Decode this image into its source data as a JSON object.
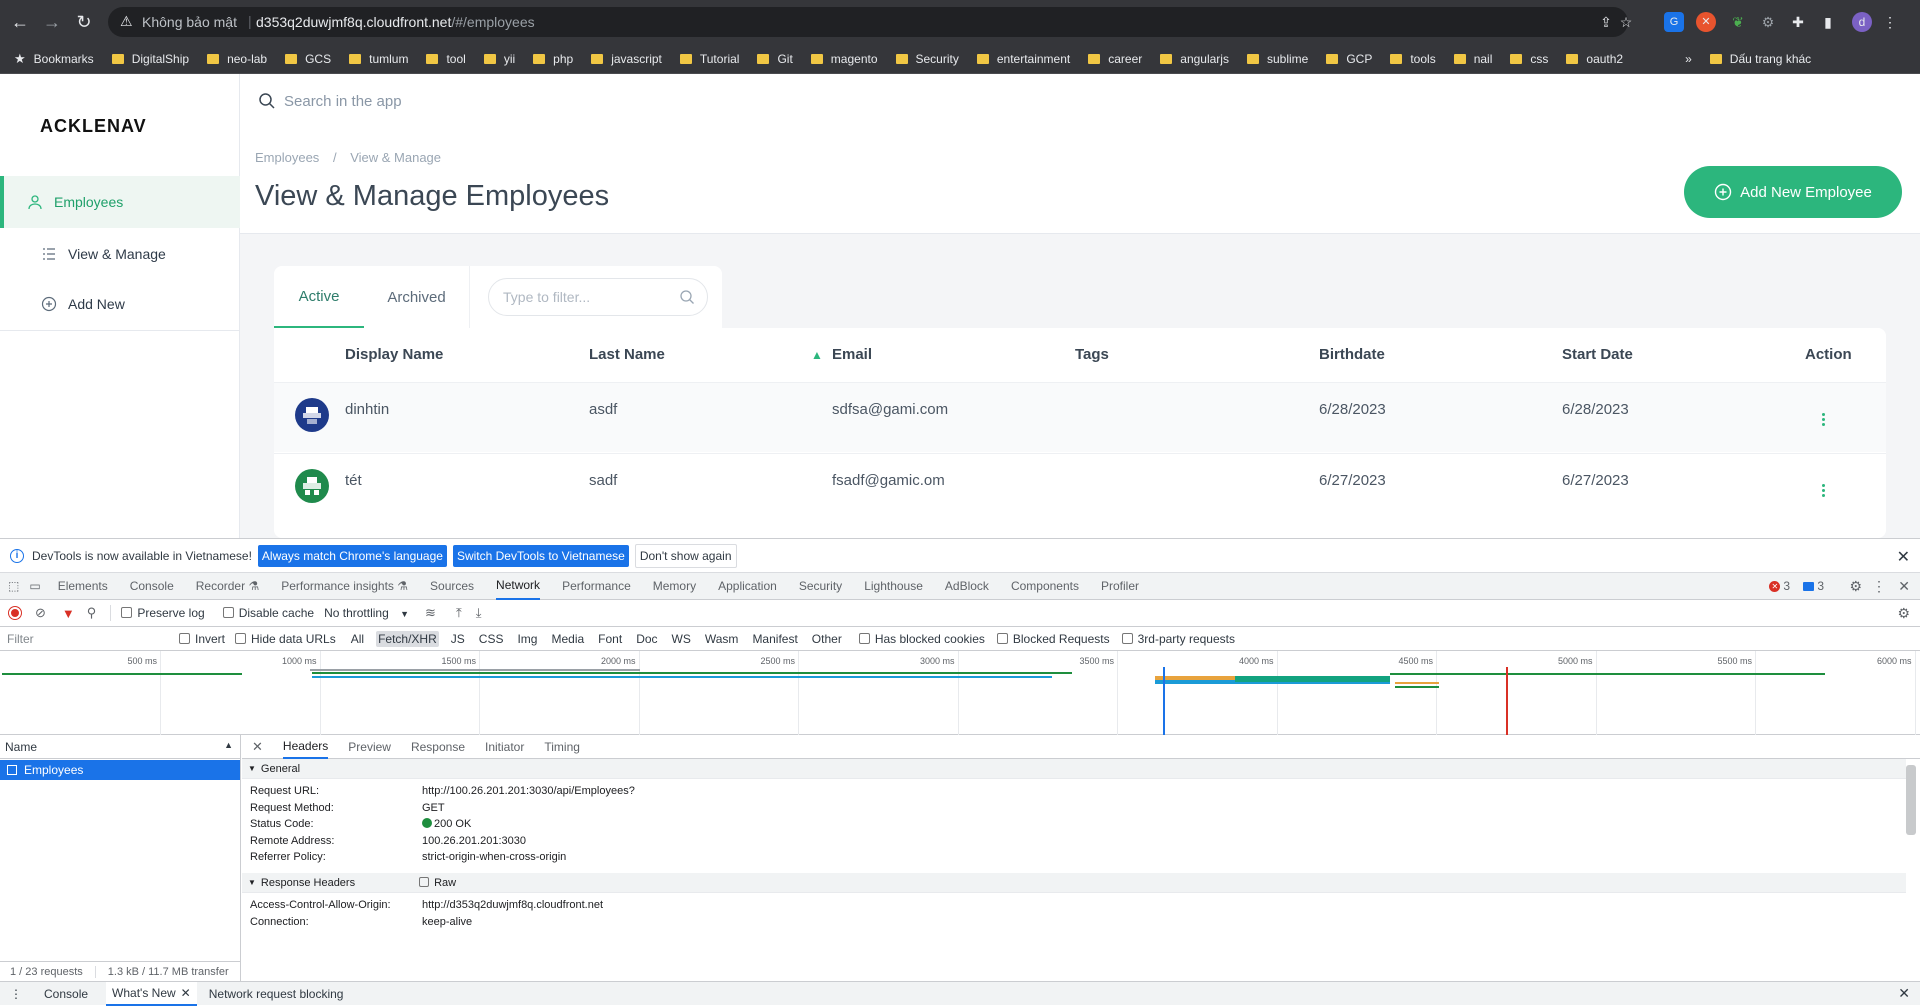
{
  "browser": {
    "security_label": "Không bảo mật",
    "url_host": "d353q2duwjmf8q.cloudfront.net",
    "url_path": "/#/employees",
    "profile_initial": "d",
    "bookmarks": [
      "Bookmarks",
      "DigitalShip",
      "neo-lab",
      "GCS",
      "tumlum",
      "tool",
      "yii",
      "php",
      "javascript",
      "Tutorial",
      "Git",
      "magento",
      "Security",
      "entertainment",
      "career",
      "angularjs",
      "sublime",
      "GCP",
      "tools",
      "nail",
      "css",
      "oauth2"
    ],
    "bookmarks_overflow": "»",
    "other_bookmarks": "Dấu trang khác"
  },
  "app": {
    "logo": "ACKLENAV",
    "sidebar": [
      {
        "label": "Employees",
        "icon": "user-icon",
        "active": true
      },
      {
        "label": "View & Manage",
        "icon": "list-icon",
        "active": false
      },
      {
        "label": "Add New",
        "icon": "plus-circle-icon",
        "active": false
      }
    ],
    "search_placeholder": "Search in the app",
    "breadcrumb": [
      "Employees",
      "/",
      "View & Manage"
    ],
    "page_title": "View & Manage Employees",
    "add_button": "Add New Employee",
    "tabs": [
      "Active",
      "Archived"
    ],
    "filter_placeholder": "Type to filter...",
    "table": {
      "headers": [
        "Display Name",
        "Last Name",
        "Email",
        "Tags",
        "Birthdate",
        "Start Date",
        "Action"
      ],
      "sort_indicator": "▲",
      "rows": [
        {
          "display_name": "dinhtin",
          "last_name": "asdf",
          "email": "sdfsa@gami.com",
          "tags": "",
          "birthdate": "6/28/2023",
          "start_date": "6/28/2023",
          "avatar_color": "#1e3a8a"
        },
        {
          "display_name": "tét",
          "last_name": "sadf",
          "email": "fsadf@gamic.om",
          "tags": "",
          "birthdate": "6/27/2023",
          "start_date": "6/27/2023",
          "avatar_color": "#1f8a4c"
        }
      ]
    },
    "accent": "#2cb67d"
  },
  "devtools": {
    "banner_text": "DevTools is now available in Vietnamese!",
    "banner_btn1": "Always match Chrome's language",
    "banner_btn2": "Switch DevTools to Vietnamese",
    "banner_btn3": "Don't show again",
    "tabs": [
      "Elements",
      "Console",
      "Recorder ⚗",
      "Performance insights ⚗",
      "Sources",
      "Network",
      "Performance",
      "Memory",
      "Application",
      "Security",
      "Lighthouse",
      "AdBlock",
      "Components",
      "Profiler"
    ],
    "active_tab": "Network",
    "errors": "3",
    "messages": "3",
    "preserve_log": "Preserve log",
    "disable_cache": "Disable cache",
    "throttling": "No throttling",
    "filter_placeholder": "Filter",
    "invert": "Invert",
    "hide_data_urls": "Hide data URLs",
    "types": [
      "All",
      "Fetch/XHR",
      "JS",
      "CSS",
      "Img",
      "Media",
      "Font",
      "Doc",
      "WS",
      "Wasm",
      "Manifest",
      "Other"
    ],
    "has_blocked_cookies": "Has blocked cookies",
    "blocked_requests": "Blocked Requests",
    "third_party": "3rd-party requests",
    "timeline_ticks": [
      "500 ms",
      "1000 ms",
      "1500 ms",
      "2000 ms",
      "2500 ms",
      "3000 ms",
      "3500 ms",
      "4000 ms",
      "4500 ms",
      "5000 ms",
      "5500 ms",
      "6000 ms"
    ],
    "name_header": "Name",
    "request_name": "Employees",
    "footer_requests": "1 / 23 requests",
    "footer_transfer": "1.3 kB / 11.7 MB transfer",
    "detail_tabs": [
      "Headers",
      "Preview",
      "Response",
      "Initiator",
      "Timing"
    ],
    "general_label": "General",
    "general": [
      {
        "k": "Request URL:",
        "v": "http://100.26.201.201:3030/api/Employees?"
      },
      {
        "k": "Request Method:",
        "v": "GET"
      },
      {
        "k": "Status Code:",
        "v": "200 OK"
      },
      {
        "k": "Remote Address:",
        "v": "100.26.201.201:3030"
      },
      {
        "k": "Referrer Policy:",
        "v": "strict-origin-when-cross-origin"
      }
    ],
    "response_headers_label": "Response Headers",
    "raw_label": "Raw",
    "response_headers": [
      {
        "k": "Access-Control-Allow-Origin:",
        "v": "http://d353q2duwjmf8q.cloudfront.net"
      },
      {
        "k": "Connection:",
        "v": "keep-alive"
      }
    ],
    "drawer_tabs": [
      "Console",
      "What's New",
      "Network request blocking"
    ]
  }
}
